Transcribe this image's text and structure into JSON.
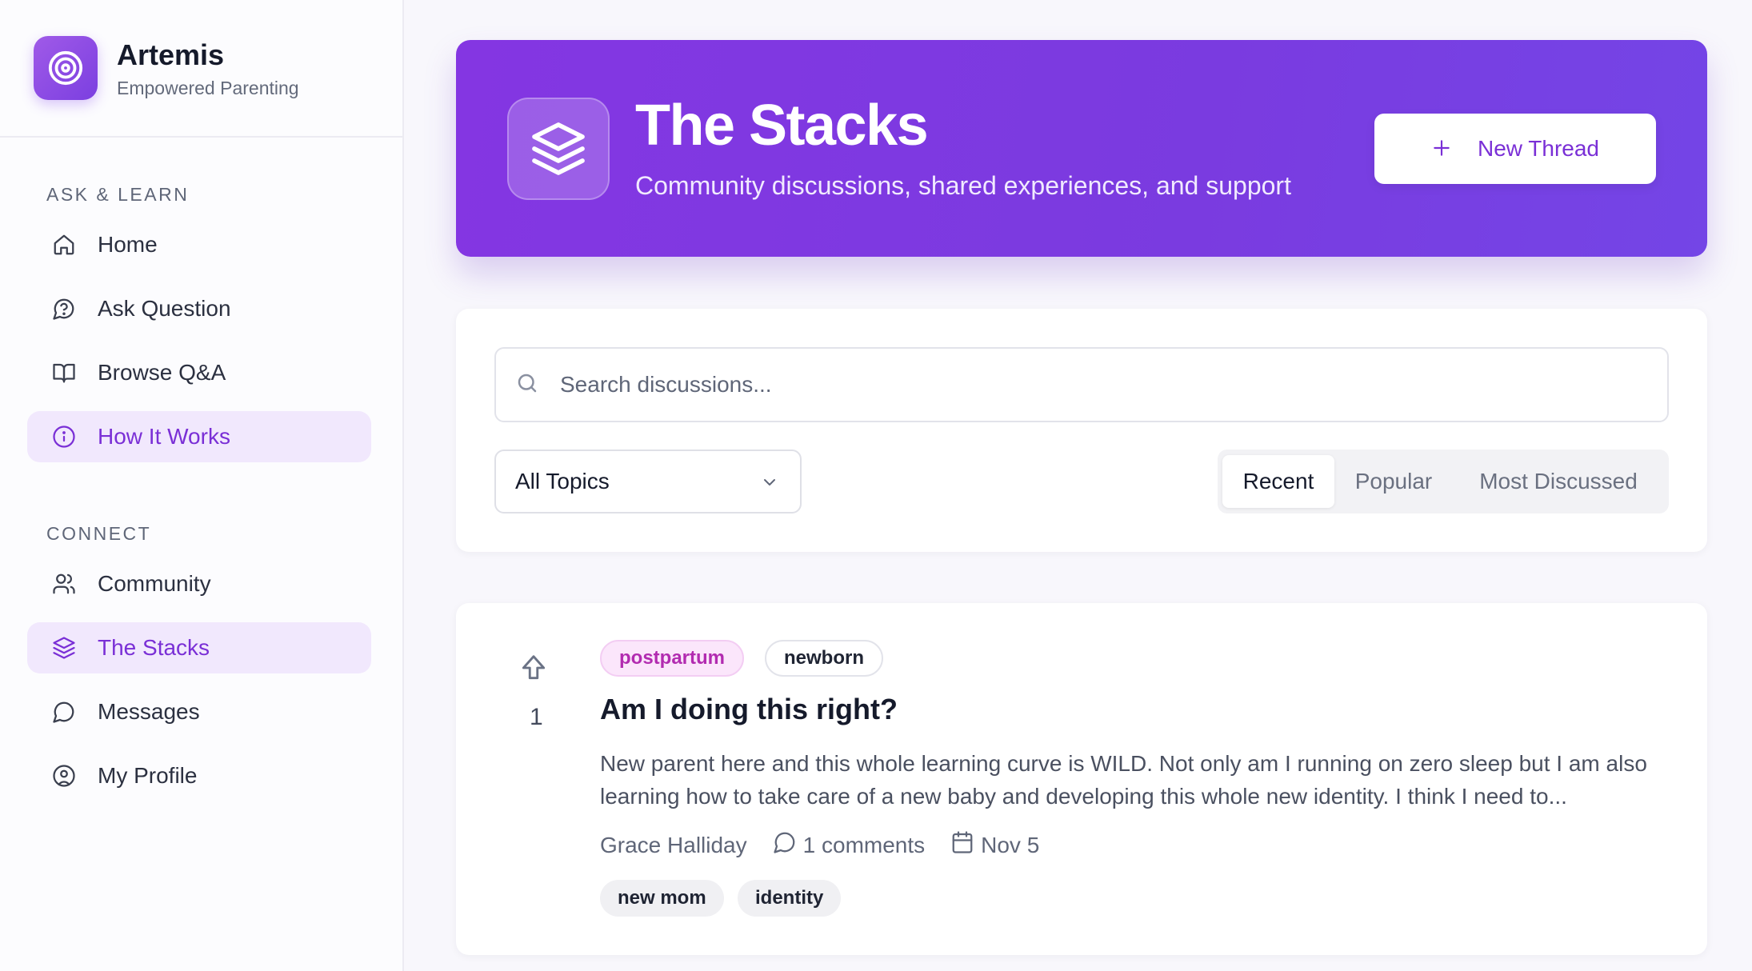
{
  "brand": {
    "name": "Artemis",
    "tagline": "Empowered Parenting",
    "logo_icon": "target-icon"
  },
  "sidebar": {
    "sections": [
      {
        "label": "ASK & LEARN"
      },
      {
        "label": "CONNECT"
      }
    ],
    "items": [
      {
        "label": "Home",
        "icon": "home-icon"
      },
      {
        "label": "Ask Question",
        "icon": "question-bubble-icon"
      },
      {
        "label": "Browse Q&A",
        "icon": "book-open-icon"
      },
      {
        "label": "How It Works",
        "icon": "info-icon",
        "active": true
      },
      {
        "label": "Community",
        "icon": "users-icon"
      },
      {
        "label": "The Stacks",
        "icon": "layers-icon",
        "active": true
      },
      {
        "label": "Messages",
        "icon": "message-circle-icon"
      },
      {
        "label": "My Profile",
        "icon": "user-circle-icon"
      }
    ]
  },
  "hero": {
    "title": "The Stacks",
    "subtitle": "Community discussions, shared experiences, and support",
    "icon": "layers-icon",
    "new_thread_label": "New Thread"
  },
  "filters": {
    "search_placeholder": "Search discussions...",
    "topic_selected": "All Topics",
    "sort_options": [
      "Recent",
      "Popular",
      "Most Discussed"
    ],
    "sort_active": "Recent"
  },
  "threads": [
    {
      "votes": "1",
      "tags_top": [
        "postpartum",
        "newborn"
      ],
      "title": "Am I doing this right?",
      "body": "New parent here and this whole learning curve is WILD. Not only am I running on zero sleep but I am also learning how to take care of a new baby and developing this whole new identity. I think I need to...",
      "author": "Grace Halliday",
      "comments": "1 comments",
      "date": "Nov 5",
      "tags_bottom": [
        "new mom",
        "identity"
      ]
    }
  ],
  "colors": {
    "accent": "#7c3aed",
    "active_bg": "#f1e8fd",
    "hero_start": "#8436e2",
    "hero_end": "#7445e6"
  }
}
